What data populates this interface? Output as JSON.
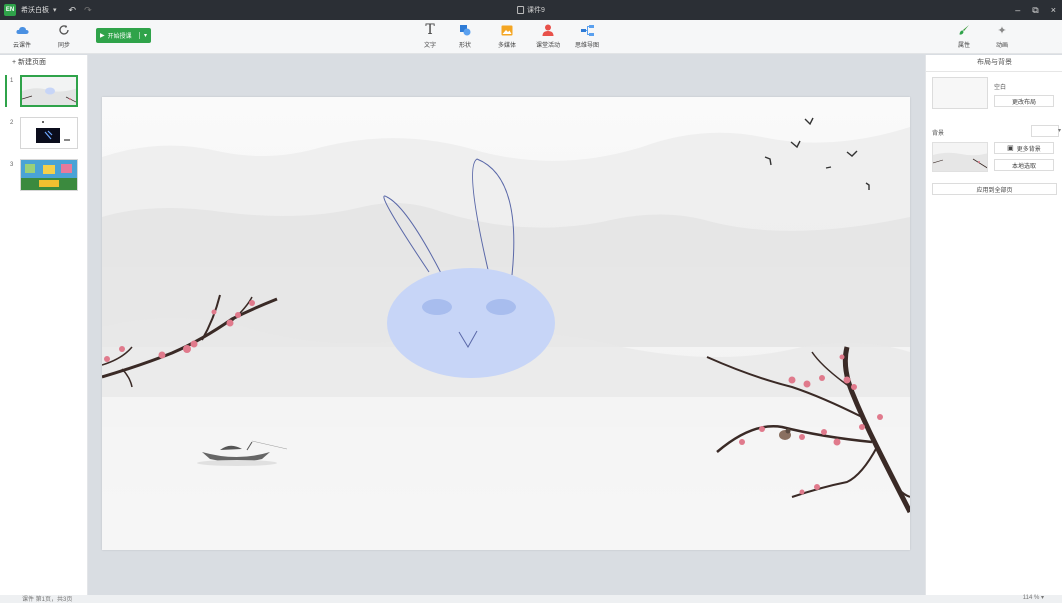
{
  "app": {
    "name": "希沃白板",
    "caret": "▾",
    "doc_title": "课件9"
  },
  "titlebar": {
    "undo": "↶",
    "redo": "↷",
    "minimize": "–",
    "restore": "⧉",
    "close": "×"
  },
  "toolbar": {
    "cloud_label": "云课件",
    "sync_label": "同步",
    "start_label": "开始授课",
    "start_caret": "▾",
    "text_label": "文字",
    "shape_label": "形状",
    "media_label": "多媒体",
    "activity_label": "课堂活动",
    "mindmap_label": "思维导图",
    "properties_label": "属性",
    "animation_label": "动画"
  },
  "left_panel": {
    "new_page_label": "+ 新建页面",
    "thumbnails": [
      {
        "num": "1"
      },
      {
        "num": "2"
      },
      {
        "num": "3"
      }
    ]
  },
  "right_panel": {
    "title": "布局与背景",
    "layout_name": "空白",
    "change_layout_label": "更改布局",
    "background_label": "背景",
    "more_backgrounds_label": "更多背景",
    "local_select_label": "本地选取",
    "apply_all_label": "应用到全部页"
  },
  "statusbar": {
    "page_info": "课件 第1页，共3页",
    "zoom": "114 % ▾"
  },
  "colors": {
    "accent": "#2fa34a",
    "rabbit_face": "#c7d5f7",
    "rabbit_eyes": "#a8bdee",
    "rabbit_ears": "#5a68a8",
    "blossom": "#e07a8c",
    "branch": "#3a2a26"
  }
}
